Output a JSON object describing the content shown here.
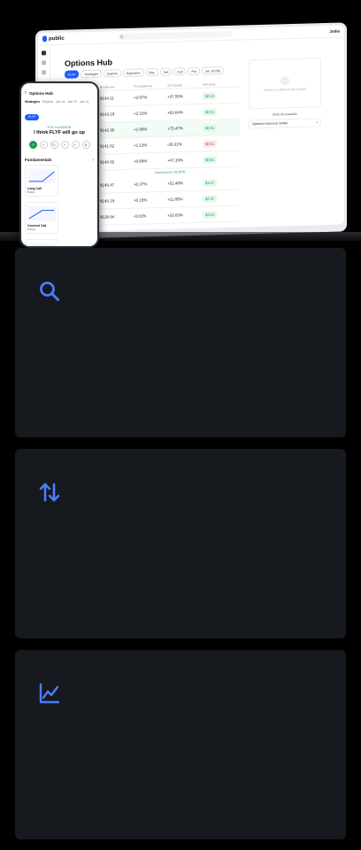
{
  "laptop": {
    "brand": "public",
    "search_placeholder": "Q",
    "user": "Jodie",
    "title": "Options Hub",
    "filters": [
      "FLYF",
      "Strategies",
      "Explore",
      "Expiration",
      "Buy",
      "Sell",
      "Call",
      "Put",
      "Jan 19 (5d)"
    ],
    "table_headers": [
      "Breakeven",
      "To breakeven",
      "1D change",
      "Ask price"
    ],
    "rows": [
      {
        "breakeven": "$144.11",
        "to_be": "+2.97%",
        "change": "+37.55%",
        "ask": "$0.13",
        "neg": false
      },
      {
        "breakeven": "$143.18",
        "to_be": "+2.31%",
        "change": "+63.64%",
        "ask": "$0.21",
        "neg": false
      },
      {
        "breakeven": "$142.30",
        "to_be": "+1.68%",
        "change": "+75.47%",
        "ask": "$0.31",
        "neg": false
      },
      {
        "breakeven": "$141.52",
        "to_be": "+1.13%",
        "change": "-28.31%",
        "ask": "$0.51",
        "neg": true
      },
      {
        "breakeven": "$140.92",
        "to_be": "+0.69%",
        "change": "+47.19%",
        "ask": "$0.81",
        "neg": false
      },
      {
        "breakeven": "$140.47",
        "to_be": "+0.37%",
        "change": "+51.48%",
        "ask": "$1.57",
        "neg": false
      },
      {
        "breakeven": "$140.18",
        "to_be": "+0.16%",
        "change": "+11.85%",
        "ask": "$2.37",
        "neg": false
      },
      {
        "breakeven": "$139.94",
        "to_be": "-0.01%",
        "change": "+33.03%",
        "ask": "$3.15",
        "neg": false
      }
    ],
    "current_price": "Current price: $139.95",
    "panel_text": "Select a contract to get started",
    "available": "$330.00 available",
    "resource": "Options resource center"
  },
  "phone": {
    "title": "Options Hub",
    "tabs": [
      "Strategies",
      "Explore",
      "Jan 16",
      "Jan 23",
      "Jan 31"
    ],
    "chip": "FLYF",
    "subtitle": "FLYF is at $139.95",
    "headline": "I think FLYF will go up",
    "icons": [
      "↗",
      "≈",
      "TL",
      "+",
      "◐",
      "$"
    ],
    "section": "Fundamentals",
    "section_link": "›",
    "cards": [
      {
        "name": "Long Call",
        "tag": "Bullish"
      },
      {
        "name": "Covered Call",
        "tag": "Bullish"
      },
      {
        "name": "Cash-Secured Put",
        "tag": "Bullish"
      }
    ]
  },
  "features": [
    {
      "icon": "search-icon"
    },
    {
      "icon": "swap-arrows-icon"
    },
    {
      "icon": "trend-chart-icon"
    }
  ],
  "colors": {
    "accent": "#4a7dff",
    "card_bg": "#16191e",
    "green": "#1a9b48",
    "red": "#d63447"
  }
}
